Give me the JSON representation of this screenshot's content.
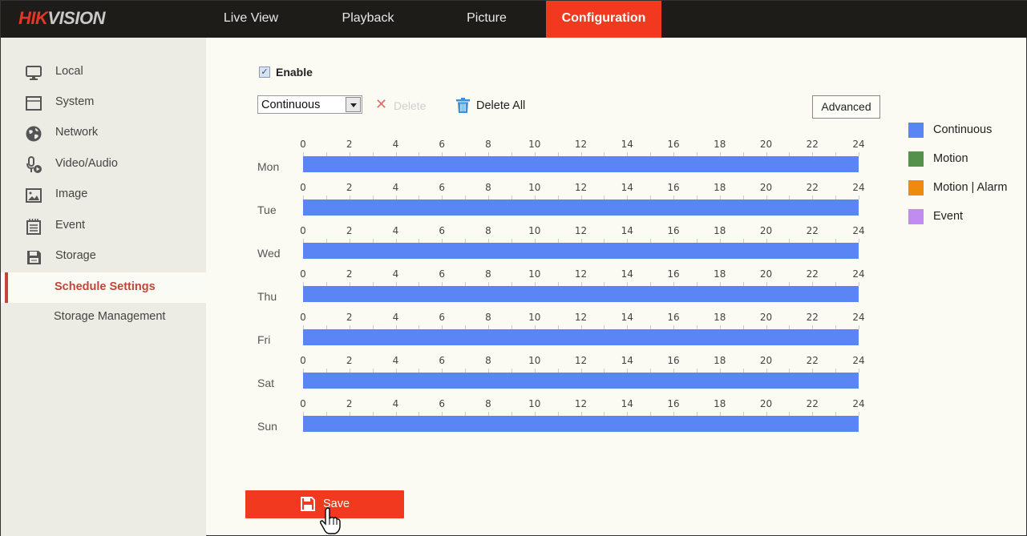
{
  "brand": {
    "part1": "HIK",
    "part2": "VISION"
  },
  "nav": {
    "tabs": [
      {
        "label": "Live View",
        "active": false
      },
      {
        "label": "Playback",
        "active": false
      },
      {
        "label": "Picture",
        "active": false
      },
      {
        "label": "Configuration",
        "active": true
      }
    ]
  },
  "sidebar": {
    "items": [
      {
        "label": "Local",
        "icon": "monitor-icon"
      },
      {
        "label": "System",
        "icon": "window-icon"
      },
      {
        "label": "Network",
        "icon": "globe-icon"
      },
      {
        "label": "Video/Audio",
        "icon": "mic-play-icon"
      },
      {
        "label": "Image",
        "icon": "image-icon"
      },
      {
        "label": "Event",
        "icon": "calendar-icon"
      },
      {
        "label": "Storage",
        "icon": "floppy-icon"
      }
    ],
    "subitems": [
      {
        "label": "Schedule Settings",
        "active": true
      },
      {
        "label": "Storage Management",
        "active": false
      }
    ]
  },
  "schedule": {
    "enable_label": "Enable",
    "enable_checked": true,
    "type_select": {
      "value": "Continuous"
    },
    "delete_label": "Delete",
    "delete_all_label": "Delete All",
    "advanced_label": "Advanced",
    "tick_labels": [
      "0",
      "2",
      "4",
      "6",
      "8",
      "10",
      "12",
      "14",
      "16",
      "18",
      "20",
      "22",
      "24"
    ],
    "hour_range": [
      0,
      24
    ],
    "days": [
      {
        "label": "Mon",
        "segments": [
          {
            "start": 0,
            "end": 24,
            "type": "Continuous"
          }
        ]
      },
      {
        "label": "Tue",
        "segments": [
          {
            "start": 0,
            "end": 24,
            "type": "Continuous"
          }
        ]
      },
      {
        "label": "Wed",
        "segments": [
          {
            "start": 0,
            "end": 24,
            "type": "Continuous"
          }
        ]
      },
      {
        "label": "Thu",
        "segments": [
          {
            "start": 0,
            "end": 24,
            "type": "Continuous"
          }
        ]
      },
      {
        "label": "Fri",
        "segments": [
          {
            "start": 0,
            "end": 24,
            "type": "Continuous"
          }
        ]
      },
      {
        "label": "Sat",
        "segments": [
          {
            "start": 0,
            "end": 24,
            "type": "Continuous"
          }
        ]
      },
      {
        "label": "Sun",
        "segments": [
          {
            "start": 0,
            "end": 24,
            "type": "Continuous"
          }
        ]
      }
    ],
    "legend": [
      {
        "label": "Continuous",
        "color": "#5a85f5"
      },
      {
        "label": "Motion",
        "color": "#55914a"
      },
      {
        "label": "Motion | Alarm",
        "color": "#ee8a0c"
      },
      {
        "label": "Event",
        "color": "#c08cf2"
      }
    ]
  },
  "save_label": "Save",
  "colors": {
    "accent": "#f1391f",
    "topbar": "#1d1c18",
    "active_sidebar": "#c3443a"
  }
}
